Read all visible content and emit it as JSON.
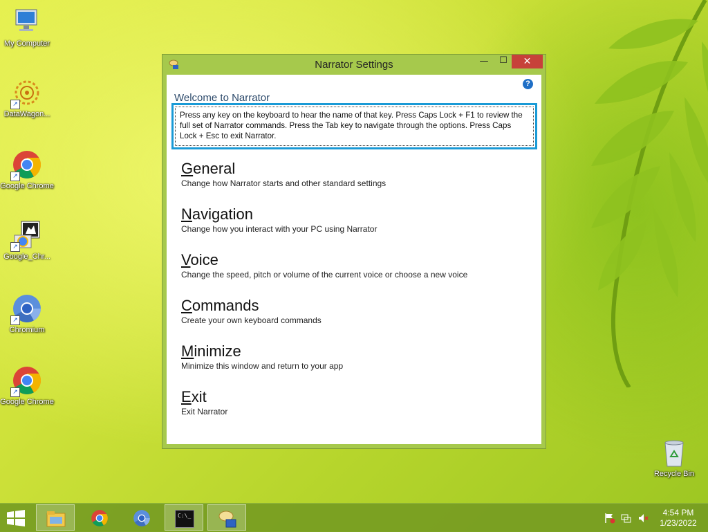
{
  "desktop": {
    "icons": [
      {
        "label": "My Computer",
        "icon": "computer-icon"
      },
      {
        "label": "DataWagon...",
        "icon": "datawagon-icon"
      },
      {
        "label": "Google Chrome",
        "icon": "chrome-icon"
      },
      {
        "label": "Google_Chr...",
        "icon": "installer-icon"
      },
      {
        "label": "Chromium",
        "icon": "chromium-icon"
      },
      {
        "label": "Google Chrome",
        "icon": "chrome-icon"
      },
      {
        "label": "Recycle Bin",
        "icon": "recycle-bin-icon"
      }
    ]
  },
  "window": {
    "title": "Narrator Settings",
    "close_glyph": "✕",
    "minimize_glyph": "—",
    "maximize_glyph": "☐",
    "help_glyph": "?",
    "welcome": "Welcome to Narrator",
    "description": "Press any key on the keyboard to hear the name of that key.  Press Caps Lock + F1 to review the full set of Narrator commands.  Press the Tab key to navigate through the options.  Press Caps Lock + Esc to exit Narrator.",
    "items": [
      {
        "first": "G",
        "rest": "eneral",
        "desc": "Change how Narrator starts and other standard settings"
      },
      {
        "first": "N",
        "rest": "avigation",
        "desc": "Change how you interact with your PC using Narrator"
      },
      {
        "first": "V",
        "rest": "oice",
        "desc": "Change the speed, pitch or volume of the current voice or choose a new voice"
      },
      {
        "first": "C",
        "rest": "ommands",
        "desc": "Create your own keyboard commands"
      },
      {
        "first": "M",
        "rest": "inimize",
        "desc": "Minimize this window and return to your app"
      },
      {
        "first": "E",
        "rest": "xit",
        "desc": "Exit Narrator"
      }
    ]
  },
  "taskbar": {
    "items": [
      {
        "name": "file-explorer",
        "icon": "folder-icon"
      },
      {
        "name": "google-chrome",
        "icon": "chrome-icon"
      },
      {
        "name": "chromium",
        "icon": "chromium-icon"
      },
      {
        "name": "command-prompt",
        "icon": "cmd-icon",
        "glyph": "C:\\_"
      },
      {
        "name": "narrator",
        "icon": "narrator-icon",
        "active": true
      }
    ],
    "clock": {
      "time": "4:54 PM",
      "date": "1/23/2022"
    }
  },
  "colors": {
    "accent_blue": "#1a9ad6",
    "close_red": "#c7413a",
    "window_frame": "#a6c94c",
    "taskbar": "#769c22"
  }
}
